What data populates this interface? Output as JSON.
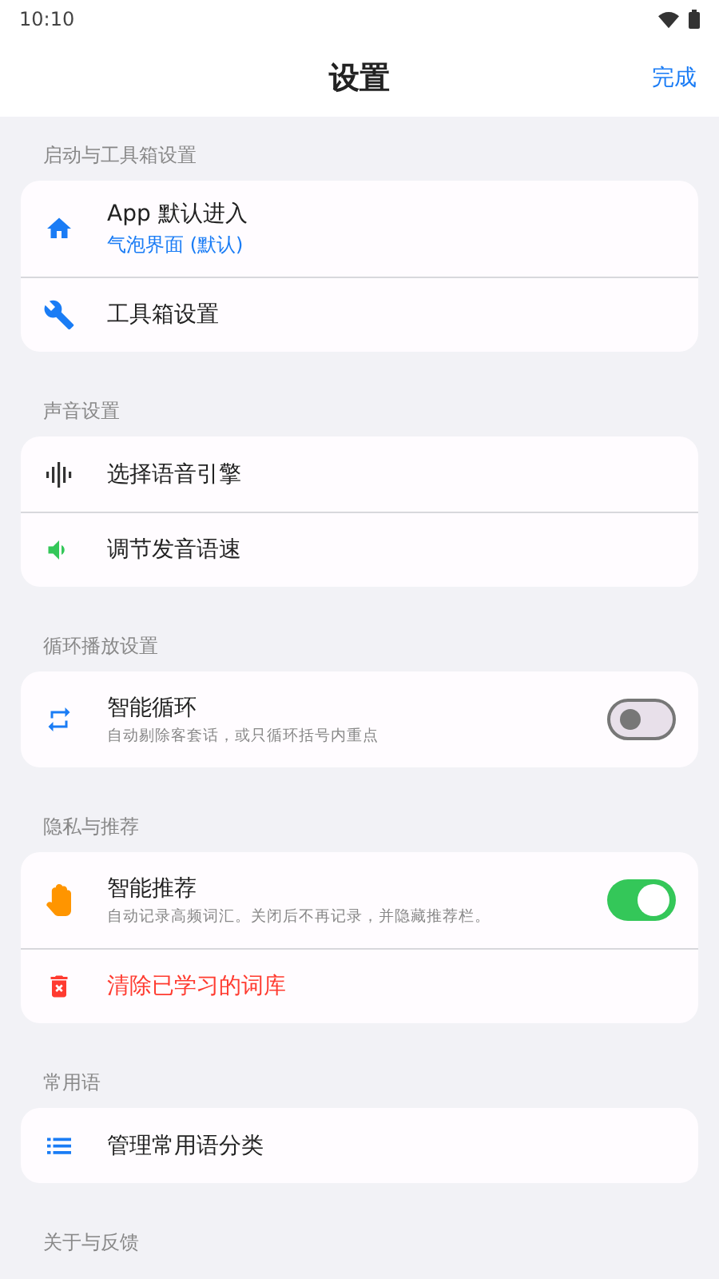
{
  "status_bar": {
    "time": "10:10"
  },
  "header": {
    "title": "设置",
    "done": "完成"
  },
  "sections": [
    {
      "title": "启动与工具箱设置",
      "rows": [
        {
          "kind": "link",
          "title": "App 默认进入",
          "value": "气泡界面 (默认)"
        },
        {
          "kind": "link",
          "title": "工具箱设置"
        }
      ]
    },
    {
      "title": "声音设置",
      "rows": [
        {
          "kind": "link",
          "title": "选择语音引擎"
        },
        {
          "kind": "link",
          "title": "调节发音语速"
        }
      ]
    },
    {
      "title": "循环播放设置",
      "rows": [
        {
          "kind": "toggle",
          "title": "智能循环",
          "description": "自动剔除客套话，或只循环括号内重点",
          "on": false
        }
      ]
    },
    {
      "title": "隐私与推荐",
      "rows": [
        {
          "kind": "toggle",
          "title": "智能推荐",
          "description": "自动记录高频词汇。关闭后不再记录，并隐藏推荐栏。",
          "on": true
        },
        {
          "kind": "destructive",
          "title": "清除已学习的词库"
        }
      ]
    },
    {
      "title": "常用语",
      "rows": [
        {
          "kind": "link",
          "title": "管理常用语分类"
        }
      ]
    },
    {
      "title": "关于与反馈"
    }
  ]
}
